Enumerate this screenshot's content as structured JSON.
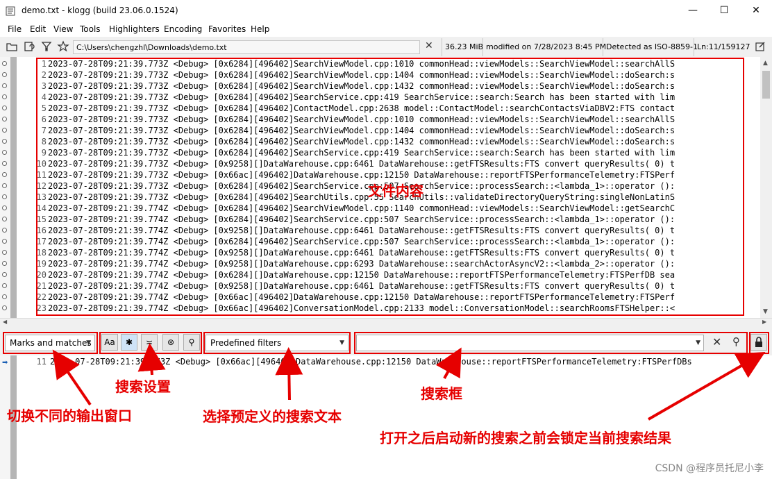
{
  "window": {
    "title": "demo.txt - klogg (build 23.06.0.1524)",
    "minimize": "—",
    "maximize": "☐",
    "close": "✕"
  },
  "menu": [
    "File",
    "Edit",
    "View",
    "Tools",
    "Highlighters",
    "Encoding",
    "Favorites",
    "Help"
  ],
  "toolbar": {
    "path": "C:\\Users\\chengzhl\\Downloads\\demo.txt",
    "clear": "✕",
    "size": "36.23 MiB",
    "modified": "modified on 7/28/2023 8:45 PM",
    "encoding": "Detected as ISO-8859-1",
    "position": "Ln:11/159127"
  },
  "log": {
    "lines": [
      {
        "n": "1",
        "t": "2023-07-28T09:21:39.773Z <Debug> [0x6284][496402]SearchViewModel.cpp:1010 commonHead::viewModels::SearchViewModel::searchAllS"
      },
      {
        "n": "2",
        "t": "2023-07-28T09:21:39.773Z <Debug> [0x6284][496402]SearchViewModel.cpp:1404 commonHead::viewModels::SearchViewModel::doSearch:s"
      },
      {
        "n": "3",
        "t": "2023-07-28T09:21:39.773Z <Debug> [0x6284][496402]SearchViewModel.cpp:1432 commonHead::viewModels::SearchViewModel::doSearch:s"
      },
      {
        "n": "4",
        "t": "2023-07-28T09:21:39.773Z <Debug> [0x6284][496402]SearchService.cpp:419 SearchService::search:Search has been started with lim"
      },
      {
        "n": "5",
        "t": "2023-07-28T09:21:39.773Z <Debug> [0x6284][496402]ContactModel.cpp:2638 model::ContactModel::searchContactsViaDBV2:FTS contact"
      },
      {
        "n": "6",
        "t": "2023-07-28T09:21:39.773Z <Debug> [0x6284][496402]SearchViewModel.cpp:1010 commonHead::viewModels::SearchViewModel::searchAllS"
      },
      {
        "n": "7",
        "t": "2023-07-28T09:21:39.773Z <Debug> [0x6284][496402]SearchViewModel.cpp:1404 commonHead::viewModels::SearchViewModel::doSearch:s"
      },
      {
        "n": "8",
        "t": "2023-07-28T09:21:39.773Z <Debug> [0x6284][496402]SearchViewModel.cpp:1432 commonHead::viewModels::SearchViewModel::doSearch:s"
      },
      {
        "n": "9",
        "t": "2023-07-28T09:21:39.773Z <Debug> [0x6284][496402]SearchService.cpp:419 SearchService::search:Search has been started with lim"
      },
      {
        "n": "10",
        "t": "2023-07-28T09:21:39.773Z <Debug> [0x9258][]DataWarehouse.cpp:6461 DataWarehouse::getFTSResults:FTS convert queryResults( 0) t"
      },
      {
        "n": "11",
        "t": "2023-07-28T09:21:39.773Z <Debug> [0x66ac][496402]DataWarehouse.cpp:12150 DataWarehouse::reportFTSPerformanceTelemetry:FTSPerf"
      },
      {
        "n": "12",
        "t": "2023-07-28T09:21:39.773Z <Debug> [0x6284][496402]SearchService.cpp:507 SearchService::processSearch::<lambda_1>::operator ():"
      },
      {
        "n": "13",
        "t": "2023-07-28T09:21:39.773Z <Debug> [0x6284][496402]SearchUtils.cpp:55 SearchUtils::validateDirectoryQueryString:singleNonLatinS"
      },
      {
        "n": "14",
        "t": "2023-07-28T09:21:39.774Z <Debug> [0x6284][496402]SearchViewModel.cpp:1140 commonHead::viewModels::SearchViewModel::getSearchC"
      },
      {
        "n": "15",
        "t": "2023-07-28T09:21:39.774Z <Debug> [0x6284][496402]SearchService.cpp:507 SearchService::processSearch::<lambda_1>::operator ():"
      },
      {
        "n": "16",
        "t": "2023-07-28T09:21:39.774Z <Debug> [0x9258][]DataWarehouse.cpp:6461 DataWarehouse::getFTSResults:FTS convert queryResults( 0) t"
      },
      {
        "n": "17",
        "t": "2023-07-28T09:21:39.774Z <Debug> [0x6284][496402]SearchService.cpp:507 SearchService::processSearch::<lambda_1>::operator ():"
      },
      {
        "n": "18",
        "t": "2023-07-28T09:21:39.774Z <Debug> [0x9258][]DataWarehouse.cpp:6461 DataWarehouse::getFTSResults:FTS convert queryResults( 0) t"
      },
      {
        "n": "19",
        "t": "2023-07-28T09:21:39.774Z <Debug> [0x9258][]DataWarehouse.cpp:6293 DataWarehouse::searchActorAsyncV2::<lambda_2>::operator ():"
      },
      {
        "n": "20",
        "t": "2023-07-28T09:21:39.774Z <Debug> [0x6284][]DataWarehouse.cpp:12150 DataWarehouse::reportFTSPerformanceTelemetry:FTSPerfDB sea"
      },
      {
        "n": "21",
        "t": "2023-07-28T09:21:39.774Z <Debug> [0x9258][]DataWarehouse.cpp:6461 DataWarehouse::getFTSResults:FTS convert queryResults( 0) t"
      },
      {
        "n": "22",
        "t": "2023-07-28T09:21:39.774Z <Debug> [0x66ac][496402]DataWarehouse.cpp:12150 DataWarehouse::reportFTSPerformanceTelemetry:FTSPerf"
      },
      {
        "n": "23",
        "t": "2023-07-28T09:21:39.774Z <Debug> [0x66ac][496402]ConversationModel.cpp:2133 model::ConversationModel::searchRoomsFTSHelper::<"
      }
    ]
  },
  "filter": {
    "output_select": "Marks and matches",
    "case_btn": "Aa",
    "regex_btn": "✱",
    "inverse_btn": "≍",
    "boolean_btn": "⊛",
    "auto_btn": "⚲",
    "predefined": "Predefined filters",
    "search_value": "",
    "clear": "✕",
    "search": "⚲",
    "lock": "🔒"
  },
  "result": {
    "line_no": "11",
    "text": "2023-07-28T09:21:39.773Z <Debug> [0x66ac][496402]DataWarehouse.cpp:12150 DataWarehouse::reportFTSPerformanceTelemetry:FTSPerfDBs"
  },
  "annotations": {
    "content": "文件内容",
    "search_settings": "搜索设置",
    "switch_output": "切换不同的输出窗口",
    "predefined": "选择预定义的搜索文本",
    "search_box": "搜索框",
    "lock": "打开之后启动新的搜索之前会锁定当前搜索结果"
  },
  "watermark": "CSDN @程序员托尼小李",
  "colors": {
    "annotation_red": "#e60000"
  }
}
